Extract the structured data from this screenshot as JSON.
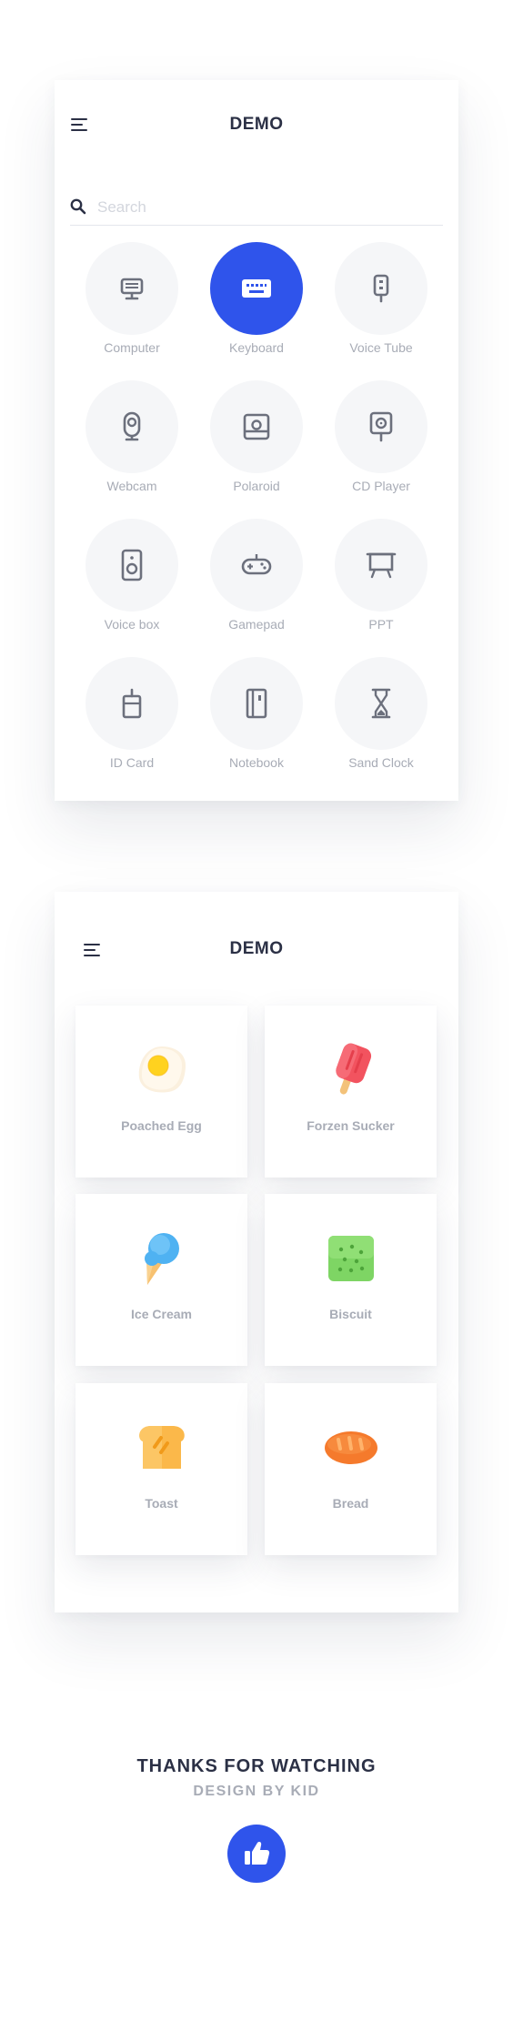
{
  "screen1": {
    "title": "DEMO",
    "search": {
      "placeholder": "Search",
      "value": ""
    },
    "items": [
      {
        "label": "Computer",
        "icon": "computer-icon",
        "active": false
      },
      {
        "label": "Keyboard",
        "icon": "keyboard-icon",
        "active": true
      },
      {
        "label": "Voice Tube",
        "icon": "microphone-icon",
        "active": false
      },
      {
        "label": "Webcam",
        "icon": "webcam-icon",
        "active": false
      },
      {
        "label": "Polaroid",
        "icon": "camera-icon",
        "active": false
      },
      {
        "label": "CD Player",
        "icon": "cd-player-icon",
        "active": false
      },
      {
        "label": "Voice box",
        "icon": "speaker-icon",
        "active": false
      },
      {
        "label": "Gamepad",
        "icon": "gamepad-icon",
        "active": false
      },
      {
        "label": "PPT",
        "icon": "presentation-icon",
        "active": false
      },
      {
        "label": "ID Card",
        "icon": "id-card-icon",
        "active": false
      },
      {
        "label": "Notebook",
        "icon": "notebook-icon",
        "active": false
      },
      {
        "label": "Sand Clock",
        "icon": "hourglass-icon",
        "active": false
      }
    ]
  },
  "screen2": {
    "title": "DEMO",
    "foods": [
      {
        "label": "Poached Egg",
        "icon": "egg-icon"
      },
      {
        "label": "Forzen Sucker",
        "icon": "popsicle-icon"
      },
      {
        "label": "Ice Cream",
        "icon": "ice-cream-icon"
      },
      {
        "label": "Biscuit",
        "icon": "biscuit-icon"
      },
      {
        "label": "Toast",
        "icon": "toast-icon"
      },
      {
        "label": "Bread",
        "icon": "bread-icon"
      }
    ]
  },
  "footer": {
    "thanks": "THANKS FOR WATCHING",
    "byline": "DESIGN BY KID",
    "like_icon": "thumbs-up-icon"
  },
  "colors": {
    "accent": "#2f54eb",
    "text_dark": "#2b3045",
    "text_muted": "#a8acb6",
    "icon_gray": "#6c707d",
    "circle_bg": "#f5f6f8"
  }
}
